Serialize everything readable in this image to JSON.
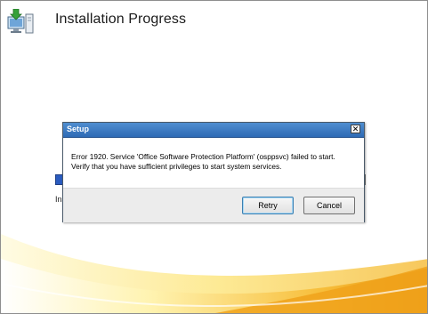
{
  "header": {
    "title": "Installation Progress",
    "icon": "install-monitor-icon"
  },
  "progress": {
    "status_text": "Ins"
  },
  "dialog": {
    "title": "Setup",
    "close_glyph": "✕",
    "message": "Error 1920. Service 'Office Software Protection Platform' (osppsvc) failed to start.  Verify that you have sufficient privileges to start system services.",
    "buttons": {
      "retry": "Retry",
      "cancel": "Cancel"
    }
  },
  "colors": {
    "titlebar": "#3a7bc6",
    "swoosh_orange": "#f2a31a",
    "swoosh_yellow": "#fde77a"
  }
}
